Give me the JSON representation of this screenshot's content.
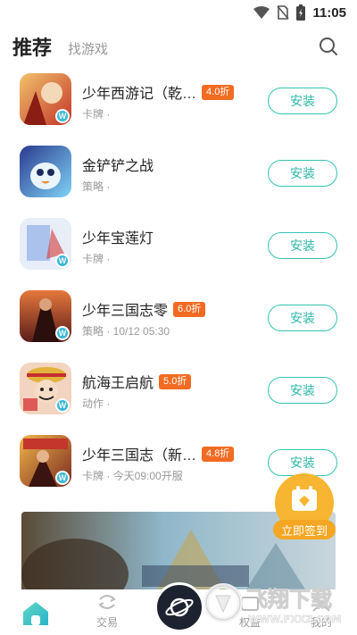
{
  "status_bar": {
    "time": "11:05",
    "icons": [
      "wifi-icon",
      "no-sim-icon",
      "battery-icon"
    ]
  },
  "header": {
    "tab_active": "推荐",
    "tab_inactive": "找游戏",
    "search_icon": "search-icon"
  },
  "games": [
    {
      "title": "少年西游记（乾…",
      "discount": "4.0折",
      "meta": "卡牌 ·",
      "button": "安装",
      "icon_colors": [
        "#c4362b",
        "#f1c26b"
      ]
    },
    {
      "title": "金铲铲之战",
      "discount": "",
      "meta": "策略 ·",
      "button": "安装",
      "icon_colors": [
        "#2a3a8f",
        "#7fd3f5"
      ]
    },
    {
      "title": "少年宝莲灯",
      "discount": "",
      "meta": "卡牌 ·",
      "button": "安装",
      "icon_colors": [
        "#e7eef8",
        "#3a6fd8"
      ]
    },
    {
      "title": "少年三国志零",
      "discount": "6.0折",
      "meta": "策略 · 10/12 05:30",
      "button": "安装",
      "icon_colors": [
        "#5a1d1a",
        "#e5783c"
      ]
    },
    {
      "title": "航海王启航",
      "discount": "5.0折",
      "meta": "动作 ·",
      "button": "安装",
      "icon_colors": [
        "#f2d4c0",
        "#d83a3a"
      ]
    },
    {
      "title": "少年三国志（新…",
      "discount": "4.8折",
      "meta": "卡牌 · 今天09:00开服",
      "button": "安装",
      "icon_colors": [
        "#7a2a20",
        "#f0b54a"
      ]
    }
  ],
  "checkin": {
    "label": "立即签到"
  },
  "bottom_nav": {
    "items": [
      {
        "label": "",
        "icon": "home-icon",
        "active": true
      },
      {
        "label": "交易",
        "icon": "trade-icon",
        "active": false
      },
      {
        "label": "",
        "icon": "planet-icon",
        "active": false
      },
      {
        "label": "权益",
        "icon": "benefit-icon",
        "active": false
      },
      {
        "label": "我的",
        "icon": "profile-icon",
        "active": false
      }
    ]
  },
  "watermark": {
    "brand": "飞翔下载",
    "url": "WWW.FXXZ.COM"
  },
  "colors": {
    "accent": "#2fb7a8",
    "discount": "#f26b22",
    "checkin": "#f5a623"
  }
}
